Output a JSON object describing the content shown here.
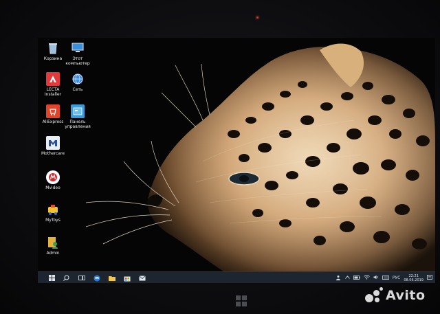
{
  "desktop": {
    "icons": [
      {
        "name": "recycle-bin-icon",
        "label": "Корзина",
        "color": "#8fb4d6"
      },
      {
        "name": "this-pc-icon",
        "label": "Этот компьютер",
        "color": "#3a8fd8"
      },
      {
        "name": "lecta-installer-icon",
        "label": "LECTA Installer",
        "color": "#e23a3a"
      },
      {
        "name": "network-icon",
        "label": "Сеть",
        "color": "#3d8be0"
      },
      {
        "name": "aliexpress-icon",
        "label": "AliExpress",
        "color": "#e0452c"
      },
      {
        "name": "control-panel-icon",
        "label": "Панель управления",
        "color": "#3b9ad9"
      },
      {
        "name": "mothercare-icon",
        "label": "Mothercare",
        "color": "#2a4f9a"
      },
      {
        "name": "mvideo-icon",
        "label": "Mvideo",
        "color": "#d9262c"
      },
      {
        "name": "mytoys-icon",
        "label": "MyToys",
        "color": "#f2c230"
      },
      {
        "name": "admin-user-icon",
        "label": "Admin",
        "color": "#e3b23c"
      }
    ]
  },
  "taskbar": {
    "icons": [
      "windows-start-icon",
      "search-icon",
      "task-view-icon",
      "edge-icon",
      "file-explorer-icon",
      "store-icon",
      "mail-icon"
    ],
    "tray": {
      "language": "РУС",
      "time": "22:21",
      "date": "08.06.2019"
    }
  },
  "watermark": {
    "brand": "Avito"
  }
}
